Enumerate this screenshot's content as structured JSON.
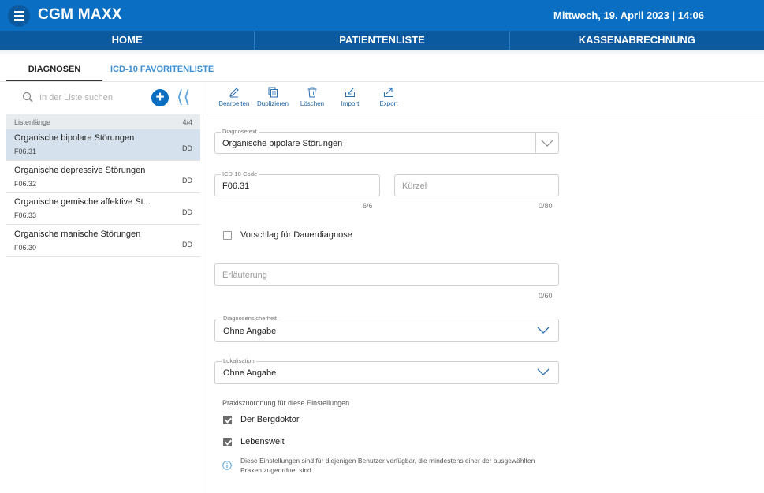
{
  "header": {
    "app_title": "CGM MAXX",
    "datetime": "Mittwoch, 19. April 2023 | 14:06"
  },
  "nav": {
    "items": [
      "HOME",
      "PATIENTENLISTE",
      "KASSENABRECHNUNG"
    ]
  },
  "tabs": {
    "items": [
      "DIAGNOSEN",
      "ICD-10 FAVORITENLISTE"
    ]
  },
  "search": {
    "placeholder": "In der Liste suchen"
  },
  "list": {
    "header_label": "Listenlänge",
    "count": "4/4",
    "items": [
      {
        "name": "Organische bipolare Störungen",
        "code": "F06.31",
        "tag": "DD"
      },
      {
        "name": "Organische depressive Störungen",
        "code": "F06.32",
        "tag": "DD"
      },
      {
        "name": "Organische gemische affektive St...",
        "code": "F06.33",
        "tag": "DD"
      },
      {
        "name": "Organische manische Störungen",
        "code": "F06.30",
        "tag": "DD"
      }
    ]
  },
  "toolbar": {
    "edit": "Bearbeiten",
    "duplicate": "Duplizieren",
    "delete": "Löschen",
    "import": "Import",
    "export": "Export"
  },
  "form": {
    "diagnosetext": {
      "label": "Diagnosetext",
      "value": "Organische bipolare Störungen"
    },
    "icd_code": {
      "label": "ICD-10-Code",
      "value": "F06.31",
      "counter": "6/6"
    },
    "kuerzel": {
      "placeholder": "Kürzel",
      "counter": "0/80"
    },
    "dauerdiagnose": {
      "label": "Vorschlag für Dauerdiagnose",
      "checked": false
    },
    "erlaeuterung": {
      "placeholder": "Erläuterung",
      "counter": "0/60"
    },
    "diagnosesicherheit": {
      "label": "Diagnosensicherheit",
      "value": "Ohne Angabe"
    },
    "lokalisation": {
      "label": "Lokalisation",
      "value": "Ohne Angabe"
    },
    "praxis": {
      "title": "Praxiszuordnung für diese Einstellungen",
      "options": [
        {
          "label": "Der Bergdoktor",
          "checked": true
        },
        {
          "label": "Lebenswelt",
          "checked": true
        }
      ],
      "info_line1": "Diese Einstellungen sind für diejenigen Benutzer verfügbar, die mindestens einer der ausgewählten",
      "info_line2": "Praxen zugeordnet sind."
    }
  },
  "colors": {
    "header_blue": "#0a6fc2",
    "nav_blue": "#0b5aa0",
    "selected_row": "#d5e2ee",
    "link_blue": "#3b8fd4"
  }
}
